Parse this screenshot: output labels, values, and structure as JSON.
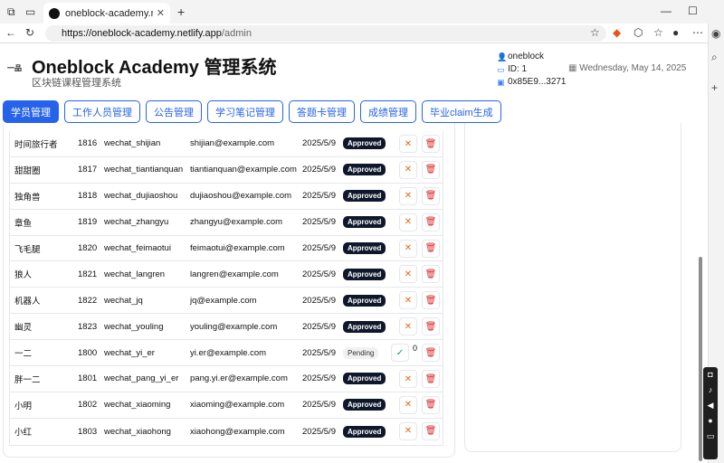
{
  "browser": {
    "tab_title": "oneblock-academy.netlify.app/ad",
    "url_domain": "https://oneblock-academy.netlify.app",
    "url_path": "/admin"
  },
  "header": {
    "logo_text": "一品",
    "title": "Oneblock Academy 管理系统",
    "subtitle": "区块链课程管理系统",
    "username": "oneblock",
    "id_label": "ID: 1",
    "wallet": "0x85E9...3271",
    "date": "Wednesday, May 14, 2025"
  },
  "nav_tabs": [
    {
      "label": "学员管理",
      "active": true
    },
    {
      "label": "工作人员管理",
      "active": false
    },
    {
      "label": "公告管理",
      "active": false
    },
    {
      "label": "学习笔记管理",
      "active": false
    },
    {
      "label": "答题卡管理",
      "active": false
    },
    {
      "label": "成绩管理",
      "active": false
    },
    {
      "label": "毕业claim生成",
      "active": false
    }
  ],
  "students": [
    {
      "name": "时间旅行者",
      "id": "1816",
      "wechat": "wechat_shijian",
      "email": "shijian@example.com",
      "date": "2025/5/9",
      "status": "Approved"
    },
    {
      "name": "甜甜圈",
      "id": "1817",
      "wechat": "wechat_tiantianquan",
      "email": "tiantianquan@example.com",
      "date": "2025/5/9",
      "status": "Approved"
    },
    {
      "name": "独角兽",
      "id": "1818",
      "wechat": "wechat_dujiaoshou",
      "email": "dujiaoshou@example.com",
      "date": "2025/5/9",
      "status": "Approved"
    },
    {
      "name": "章鱼",
      "id": "1819",
      "wechat": "wechat_zhangyu",
      "email": "zhangyu@example.com",
      "date": "2025/5/9",
      "status": "Approved"
    },
    {
      "name": "飞毛腿",
      "id": "1820",
      "wechat": "wechat_feimaotui",
      "email": "feimaotui@example.com",
      "date": "2025/5/9",
      "status": "Approved"
    },
    {
      "name": "狼人",
      "id": "1821",
      "wechat": "wechat_langren",
      "email": "langren@example.com",
      "date": "2025/5/9",
      "status": "Approved"
    },
    {
      "name": "机器人",
      "id": "1822",
      "wechat": "wechat_jq",
      "email": "jq@example.com",
      "date": "2025/5/9",
      "status": "Approved"
    },
    {
      "name": "幽灵",
      "id": "1823",
      "wechat": "wechat_youling",
      "email": "youling@example.com",
      "date": "2025/5/9",
      "status": "Approved"
    },
    {
      "name": "一二",
      "id": "1800",
      "wechat": "wechat_yi_er",
      "email": "yi.er@example.com",
      "date": "2025/5/9",
      "status": "Pending",
      "count": "0"
    },
    {
      "name": "胖一二",
      "id": "1801",
      "wechat": "wechat_pang_yi_er",
      "email": "pang.yi.er@example.com",
      "date": "2025/5/9",
      "status": "Approved"
    },
    {
      "name": "小明",
      "id": "1802",
      "wechat": "wechat_xiaoming",
      "email": "xiaoming@example.com",
      "date": "2025/5/9",
      "status": "Approved"
    },
    {
      "name": "小红",
      "id": "1803",
      "wechat": "wechat_xiaohong",
      "email": "xiaohong@example.com",
      "date": "2025/5/9",
      "status": "Approved"
    }
  ],
  "icons": {
    "reject": "close-icon",
    "delete": "trash-icon",
    "approve": "check-icon"
  },
  "colors": {
    "primary": "#2563eb",
    "approved_badge": "#0f172a",
    "pending_badge": "#f1f1f1",
    "delete": "#dc2626",
    "reject": "#e56a1c",
    "approve": "#16a34a"
  }
}
